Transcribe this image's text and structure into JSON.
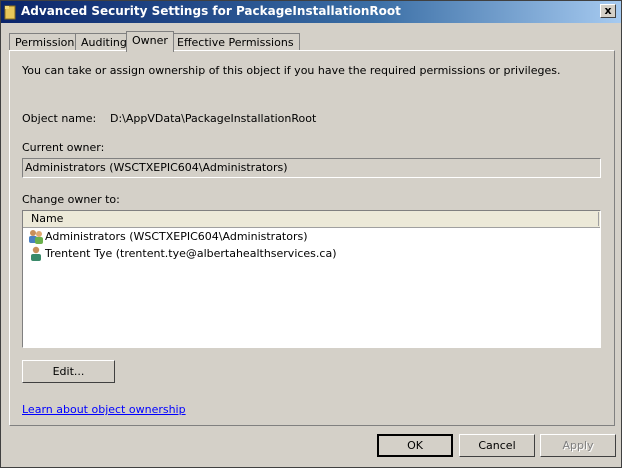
{
  "window": {
    "title": "Advanced Security Settings for PackageInstallationRoot",
    "close_label": "x"
  },
  "tabs": [
    {
      "label": "Permissions",
      "active": false
    },
    {
      "label": "Auditing",
      "active": false
    },
    {
      "label": "Owner",
      "active": true
    },
    {
      "label": "Effective Permissions",
      "active": false
    }
  ],
  "owner": {
    "intro": "You can take or assign ownership of this object if you have the required permissions or privileges.",
    "object_name_label": "Object name:",
    "object_name_value": "D:\\AppVData\\PackageInstallationRoot",
    "current_owner_label": "Current owner:",
    "current_owner_value": "Administrators (WSCTXEPIC604\\Administrators)",
    "change_owner_label": "Change owner to:",
    "list_header": "Name",
    "list_items": [
      {
        "label": "Administrators (WSCTXEPIC604\\Administrators)",
        "icon": "group-icon"
      },
      {
        "label": "Trentent Tye (trentent.tye@albertahealthservices.ca)",
        "icon": "user-icon"
      }
    ],
    "edit_button": "Edit...",
    "learn_link": "Learn about object ownership"
  },
  "buttons": {
    "ok": "OK",
    "cancel": "Cancel",
    "apply": "Apply"
  },
  "colors": {
    "titlebar_start": "#0a246a",
    "titlebar_end": "#a6caf0",
    "face": "#d4d0c8",
    "link": "#0000ff"
  }
}
